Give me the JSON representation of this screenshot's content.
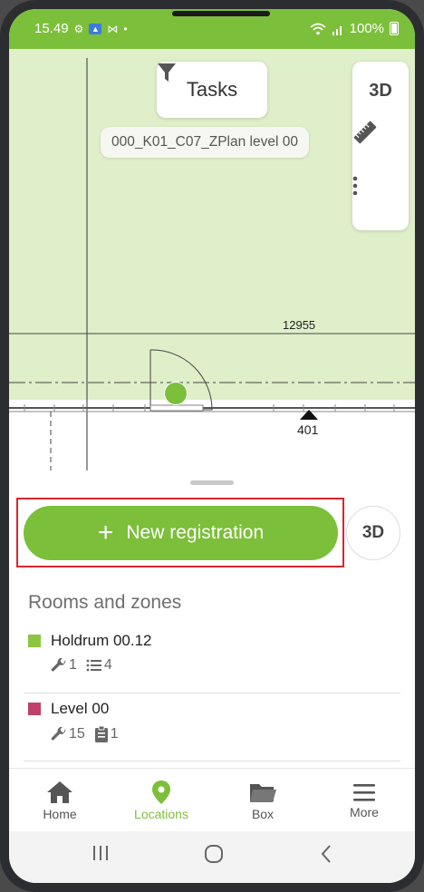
{
  "status_bar": {
    "time": "15.49",
    "battery": "100%",
    "icons": [
      "gear-icon",
      "gallery-icon",
      "mail-icon",
      "dot-icon",
      "wifi-icon",
      "signal-icon",
      "battery-icon"
    ]
  },
  "map": {
    "filter_button_label": "Tasks",
    "plan_name": "000_K01_C07_ZPlan level 00",
    "dimension_label": "12955",
    "marker_label": "401",
    "toolbar": {
      "three_d_label": "3D",
      "icons": [
        "ruler-icon",
        "more-vertical-icon"
      ]
    }
  },
  "sheet": {
    "new_registration_label": "New registration",
    "three_d_button_label": "3D",
    "section_title": "Rooms and zones",
    "rooms": [
      {
        "name": "Holdrum 00.12",
        "color": "#8cc63f",
        "tools_count": "1",
        "list_count": "4"
      },
      {
        "name": "Level 00",
        "color": "#c0406a",
        "tools_count": "15",
        "clipboard_count": "1"
      }
    ]
  },
  "bottom_nav": {
    "items": [
      {
        "label": "Home",
        "icon": "home-icon"
      },
      {
        "label": "Locations",
        "icon": "location-pin-icon",
        "active": true
      },
      {
        "label": "Box",
        "icon": "folder-icon"
      },
      {
        "label": "More",
        "icon": "menu-icon"
      }
    ]
  },
  "colors": {
    "accent": "#7cbf3a",
    "map_background": "#dfefc9",
    "highlight": "#d9262e"
  }
}
